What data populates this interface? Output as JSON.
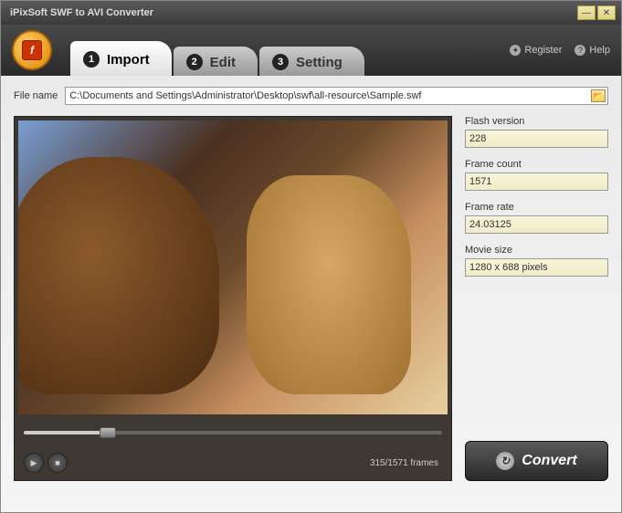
{
  "title": "iPixSoft SWF to AVI Converter",
  "tabs": [
    {
      "num": "1",
      "label": "Import"
    },
    {
      "num": "2",
      "label": "Edit"
    },
    {
      "num": "3",
      "label": "Setting"
    }
  ],
  "header_links": {
    "register": "Register",
    "help": "Help"
  },
  "file": {
    "label": "File name",
    "path": "C:\\Documents and Settings\\Administrator\\Desktop\\swf\\all-resource\\Sample.swf"
  },
  "playback": {
    "frame_text": "315/1571 frames"
  },
  "info": {
    "flash_version": {
      "label": "Flash version",
      "value": "228"
    },
    "frame_count": {
      "label": "Frame count",
      "value": "1571"
    },
    "frame_rate": {
      "label": "Frame rate",
      "value": "24.03125"
    },
    "movie_size": {
      "label": "Movie size",
      "value": "1280 x 688 pixels"
    }
  },
  "convert_label": "Convert"
}
